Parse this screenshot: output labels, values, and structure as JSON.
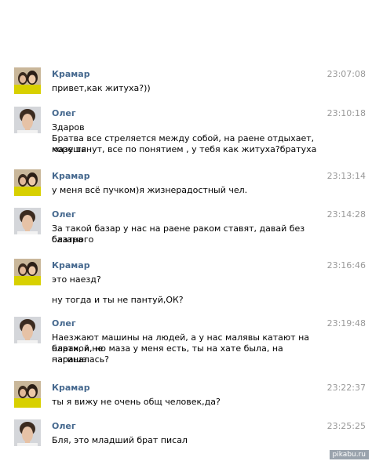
{
  "messages": [
    {
      "sender": "Крамар",
      "avatar": "kramar-avatar",
      "time": "23:07:08",
      "lines": [
        "привет,как житуха?))"
      ]
    },
    {
      "sender": "Олег",
      "avatar": "oleg-avatar",
      "time": "23:10:18",
      "lines": [
        "Здаров",
        "Братва все стреляется между собой, на раене отдыхает, кореша",
        "мазу тянут, все по понятием , у тебя как житуха?братуха"
      ]
    },
    {
      "sender": "Крамар",
      "avatar": "kramar-avatar",
      "time": "23:13:14",
      "lines": [
        "у меня всё пучком)я жизнерадостный чел."
      ]
    },
    {
      "sender": "Олег",
      "avatar": "oleg-avatar",
      "time": "23:14:28",
      "lines": [
        "За такой базар у нас на раене раком ставят, давай без блатного",
        "базара"
      ]
    },
    {
      "sender": "Крамар",
      "avatar": "kramar-avatar",
      "time": "23:16:46",
      "lines": [
        "это наезд?",
        "ну тогда и ты не пантуй,ОК?"
      ]
    },
    {
      "sender": "Олег",
      "avatar": "oleg-avatar",
      "time": "23:19:48",
      "lines": [
        "Наезжают машины на людей, а у нас малявы катают на нарах, я не",
        "блатной, но маза у меня есть, ты на хате была, на параше",
        "нагиналась?"
      ]
    },
    {
      "sender": "Крамар",
      "avatar": "kramar-avatar",
      "time": "23:22:37",
      "lines": [
        "ты я вижу не очень общ человек,да?"
      ]
    },
    {
      "sender": "Олег",
      "avatar": "oleg-avatar",
      "time": "23:25:25",
      "lines": [
        "Бля, это младший брат писал"
      ]
    }
  ],
  "watermark": "pikabu.ru",
  "colors": {
    "sender_name": "#45688e",
    "timestamp": "#999999",
    "text": "#000000",
    "background": "#ffffff"
  }
}
